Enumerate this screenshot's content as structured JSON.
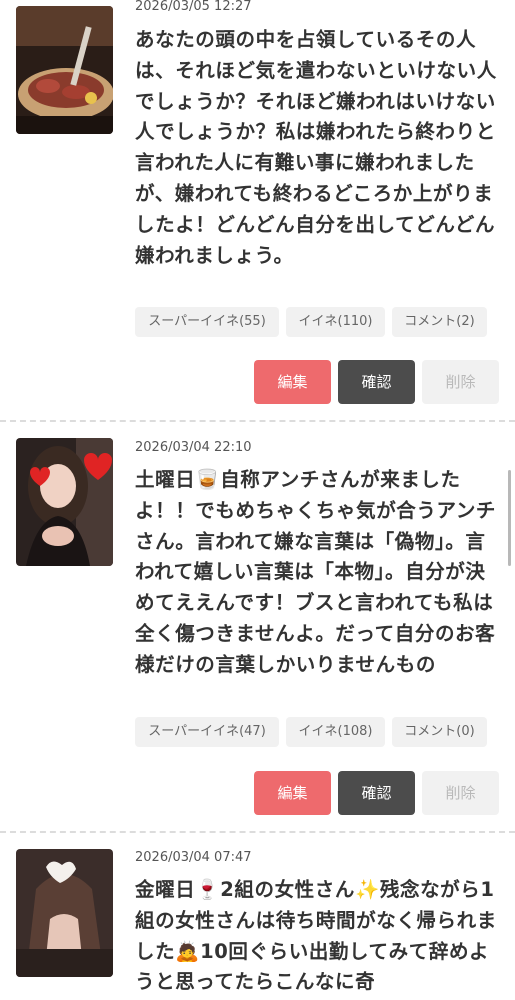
{
  "posts": [
    {
      "date": "2026/03/05 12:27",
      "text": "あなたの頭の中を占領しているその人は、それほど気を遣わないといけない人でしょうか？それほど嫌われはいけない人でしょうか？私は嫌われたら終わりと言われた人に有難い事に嫌われましたが、嫌われても終わるどころか上がりましたよ！どんどん自分を出してどんどん嫌われましょう。",
      "super_like": "スーパーイイネ(55)",
      "like": "イイネ(110)",
      "comment": "コメント(2)",
      "edit": "編集",
      "confirm": "確認",
      "delete": "削除"
    },
    {
      "date": "2026/03/04 22:10",
      "text_parts": [
        "土曜日",
        "自称アンチさんが来ましたよ！！でもめちゃくちゃ気が合うアンチさん。言われて嫌な言葉は「偽物」。言われて嬉しい言葉は「本物」。自分が決めてええんです！ブスと言われても私は全く傷つきませんよ。だって自分のお客様だけの言葉しかいりませんもの"
      ],
      "emoji": "🥃",
      "super_like": "スーパーイイネ(47)",
      "like": "イイネ(108)",
      "comment": "コメント(0)",
      "edit": "編集",
      "confirm": "確認",
      "delete": "削除"
    },
    {
      "date": "2026/03/04 07:47",
      "text_parts": [
        "金曜日",
        "2組の女性さん",
        "残念ながら1組の女性さんは待ち時間がなく帰られました",
        "10回ぐらい出勤してみて辞めようと思ってたらこんなに奇"
      ],
      "emojis": [
        "🍷",
        "✨",
        "🙇"
      ]
    }
  ],
  "colors": {
    "edit": "#ee6a6d",
    "confirm": "#4c4c4c",
    "delete_bg": "#f1f1f1",
    "chip_bg": "#f1f1f1"
  },
  "icons": [
    "wine-glass-emoji",
    "whisky-glass-emoji",
    "sparkles-emoji",
    "bowing-person-emoji"
  ]
}
